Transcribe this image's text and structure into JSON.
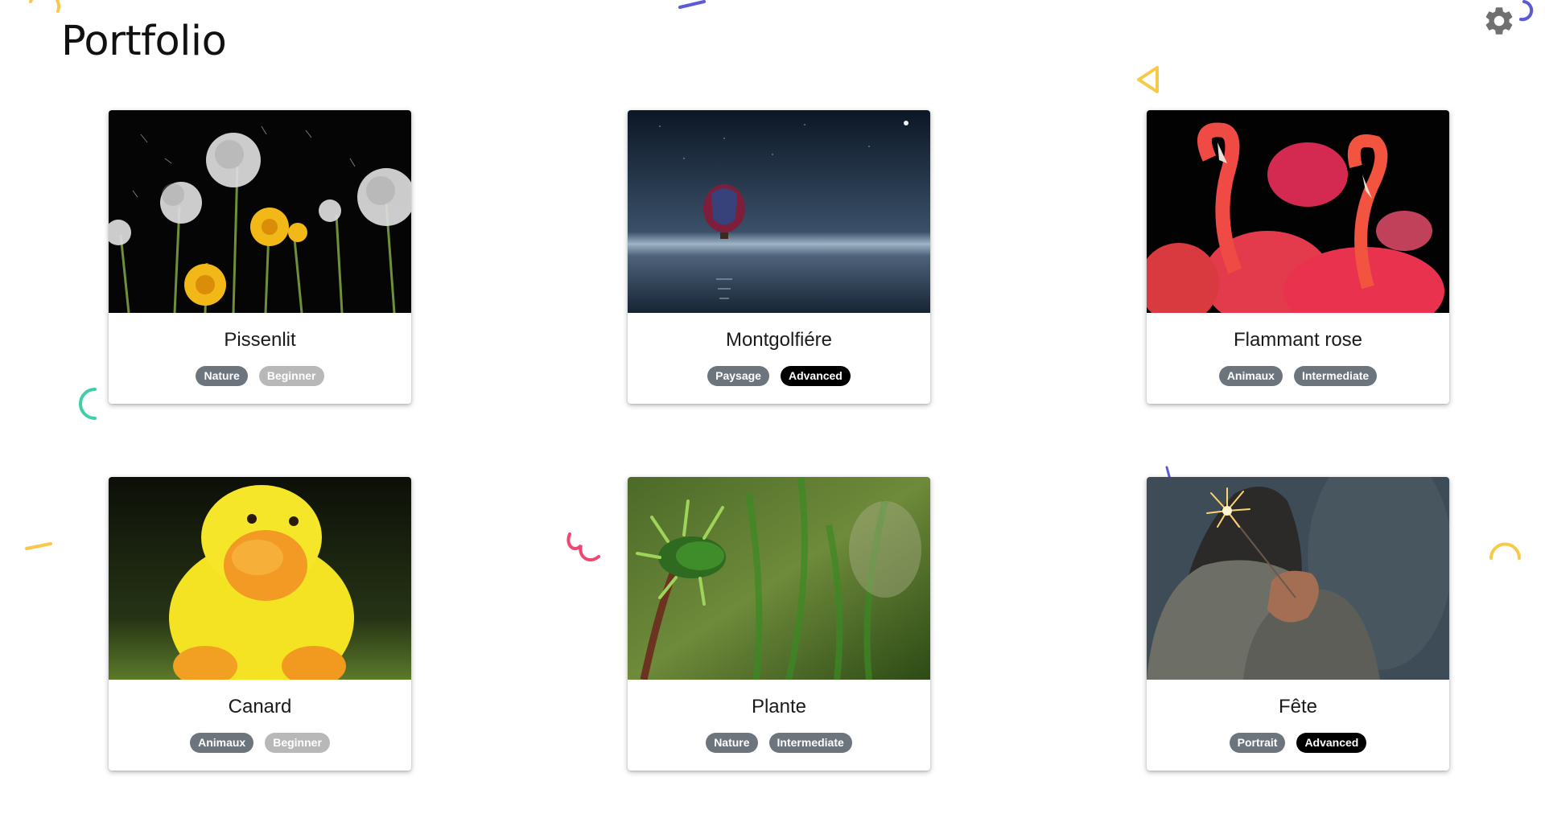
{
  "page": {
    "title": "Portfolio",
    "settings_icon": "gear-icon"
  },
  "colors": {
    "tag_category": "#6c757d",
    "tag_beginner": "#b8b8b8",
    "tag_intermediate": "#6c757d",
    "tag_advanced": "#000000",
    "decor_yellow": "#f7c948",
    "decor_purple": "#5b5bd6",
    "decor_teal": "#3ecfa8",
    "decor_red": "#ef476f"
  },
  "cards": [
    {
      "title": "Pissenlit",
      "category": "Nature",
      "level": "Beginner",
      "image": "dandelions-on-black-photo"
    },
    {
      "title": "Montgolfiére",
      "category": "Paysage",
      "level": "Advanced",
      "image": "hot-air-balloon-night-sea-photo"
    },
    {
      "title": "Flammant rose",
      "category": "Animaux",
      "level": "Intermediate",
      "image": "flamingos-photo"
    },
    {
      "title": "Canard",
      "category": "Animaux",
      "level": "Beginner",
      "image": "yellow-plush-duck-photo"
    },
    {
      "title": "Plante",
      "category": "Nature",
      "level": "Intermediate",
      "image": "green-plant-bud-photo"
    },
    {
      "title": "Fête",
      "category": "Portrait",
      "level": "Advanced",
      "image": "sparkler-in-hands-photo"
    }
  ]
}
